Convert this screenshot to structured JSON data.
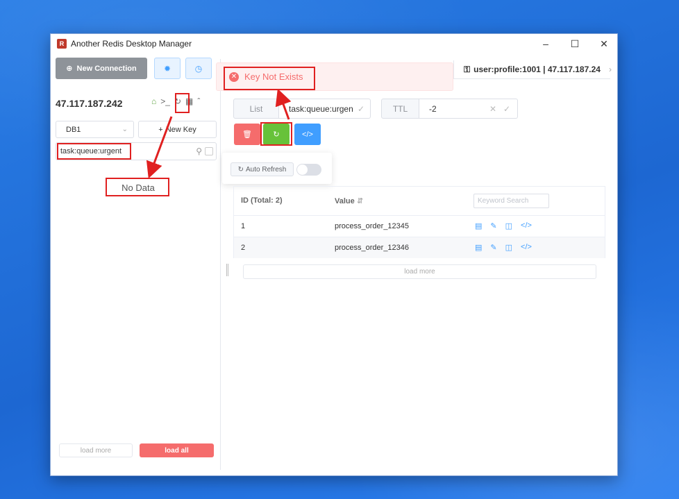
{
  "window": {
    "title": "Another Redis Desktop Manager",
    "app_icon_glyph": "R",
    "controls": [
      "minimize-icon",
      "maximize-icon",
      "close-icon"
    ]
  },
  "sidebar": {
    "new_connection_label": "New Connection",
    "server_name": "47.117.187.242",
    "db_selected": "DB1",
    "new_key_label": "New Key",
    "search_value": "task:queue:urgent",
    "empty_text": "No Data",
    "load_more_label": "load more",
    "load_all_label": "load all"
  },
  "tab": {
    "label": "user:profile:1001 | 47.117.187.24"
  },
  "toast": {
    "message": "Key Not Exists"
  },
  "key_editor": {
    "type": "List",
    "key_name": "task:queue:urgen",
    "ttl_label": "TTL",
    "ttl_value": "-2",
    "auto_refresh_label": "Auto Refresh",
    "auto_refresh_enabled": false
  },
  "table": {
    "headers": [
      "ID (Total: 2)",
      "Value"
    ],
    "keyword_placeholder": "Keyword Search",
    "rows": [
      {
        "id": "1",
        "value": "process_order_12345"
      },
      {
        "id": "2",
        "value": "process_order_12346"
      }
    ],
    "load_more_label": "load more"
  },
  "colors": {
    "accent": "#409eff",
    "danger": "#f56c6c",
    "success": "#67c23a",
    "annotation": "#e02020"
  }
}
